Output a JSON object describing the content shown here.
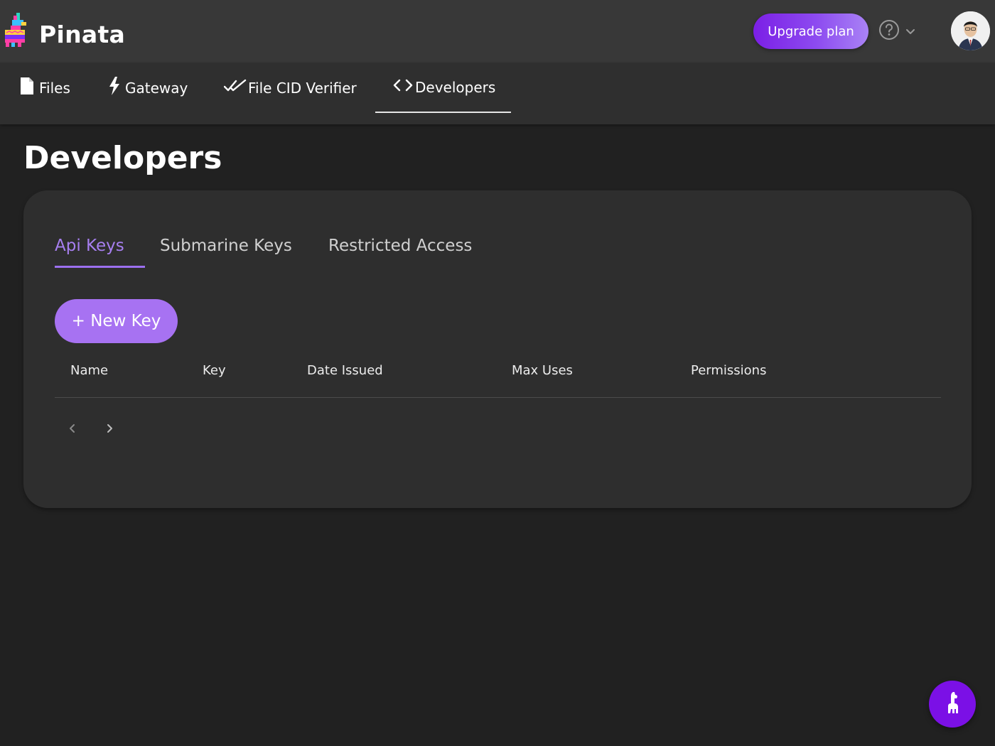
{
  "header": {
    "brand": "Pinata",
    "upgrade_label": "Upgrade plan",
    "help_icon": "question-circle-icon",
    "avatar_alt": "user-avatar"
  },
  "nav": {
    "items": [
      {
        "label": "Files",
        "icon": "file-icon"
      },
      {
        "label": "Gateway",
        "icon": "lightning-bolt-icon"
      },
      {
        "label": "File CID Verifier",
        "icon": "double-check-icon"
      },
      {
        "label": "Developers",
        "icon": "code-icon",
        "active": true
      }
    ]
  },
  "page": {
    "title": "Developers"
  },
  "card": {
    "tabs": [
      {
        "label": "Api Keys",
        "active": true
      },
      {
        "label": "Submarine Keys"
      },
      {
        "label": "Restricted Access"
      }
    ],
    "new_key_label": "+ New Key",
    "table": {
      "columns": [
        "Name",
        "Key",
        "Date Issued",
        "Max Uses",
        "Permissions"
      ],
      "rows": []
    }
  },
  "colors": {
    "accent": "#a772f2",
    "brand_purple": "#7b10e6",
    "header_bg": "#383838",
    "nav_bg": "#2f2f2f",
    "page_bg": "#212121",
    "card_bg": "#2e2e2e"
  }
}
